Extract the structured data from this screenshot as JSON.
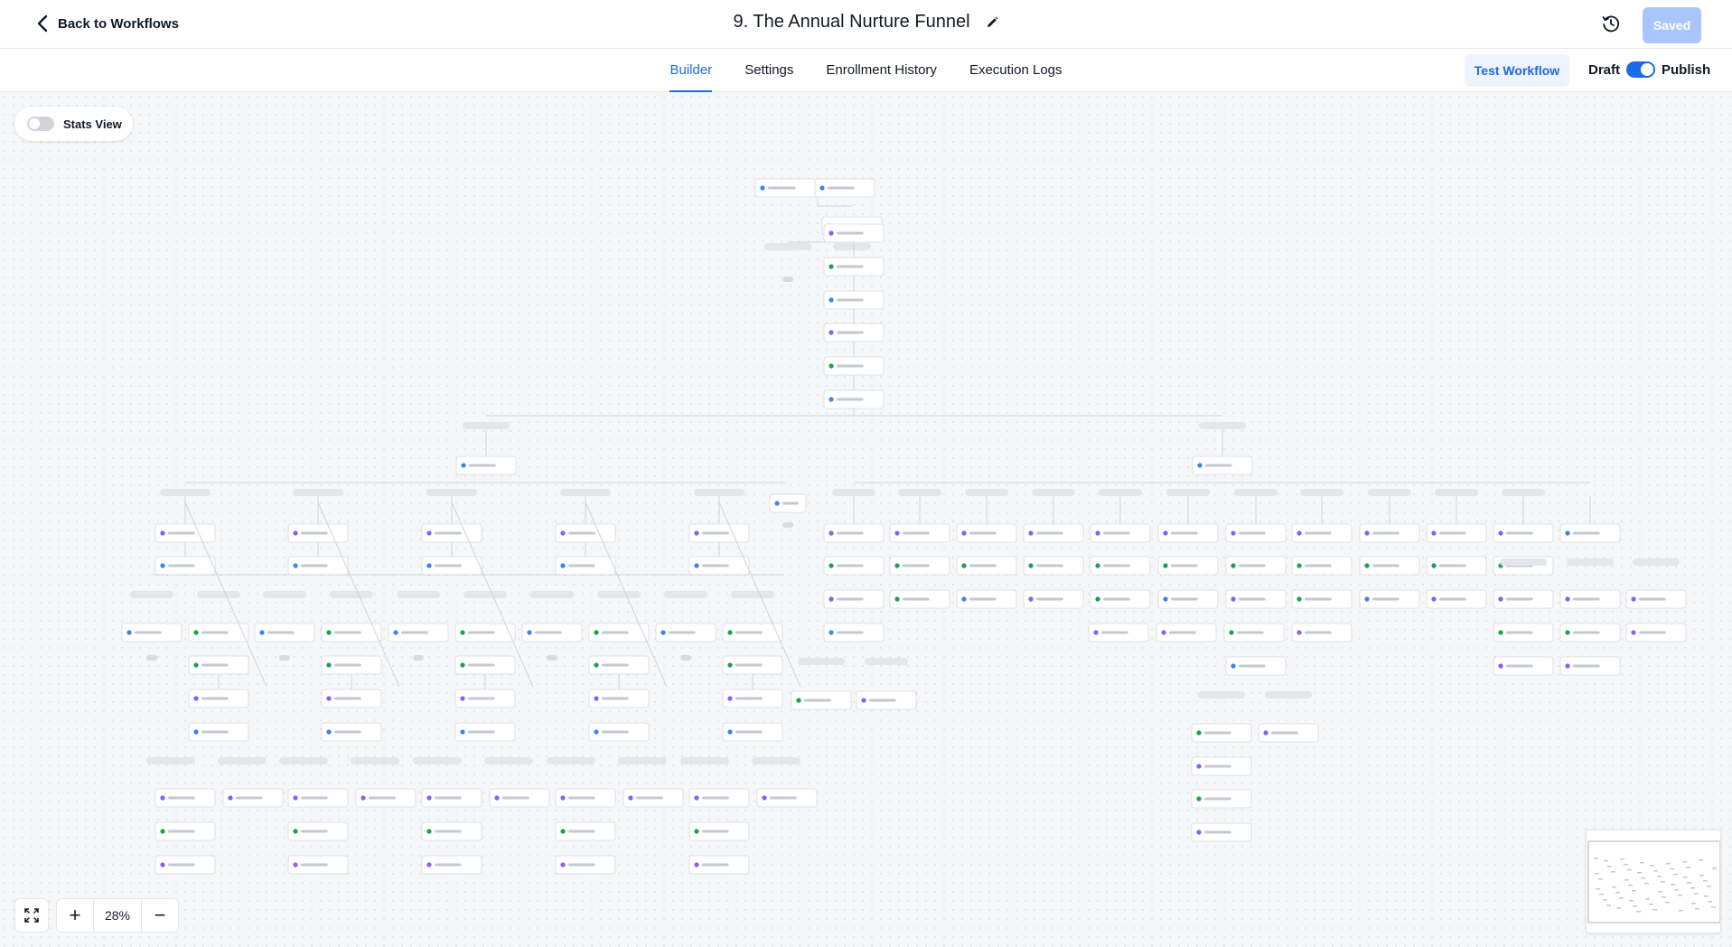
{
  "header": {
    "back_label": "Back to Workflows",
    "title": "9. The Annual Nurture Funnel",
    "saved_label": "Saved"
  },
  "tabs": [
    {
      "label": "Builder",
      "active": true
    },
    {
      "label": "Settings",
      "active": false
    },
    {
      "label": "Enrollment History",
      "active": false
    },
    {
      "label": "Execution Logs",
      "active": false
    }
  ],
  "actions": {
    "test_label": "Test Workflow",
    "draft_label": "Draft",
    "publish_label": "Publish",
    "publish_on": true
  },
  "canvas": {
    "stats_label": "Stats View",
    "stats_on": false,
    "zoom": "28%",
    "zoom_in": "+",
    "zoom_out": "−"
  },
  "colors": {
    "accent": "#1d6ae5",
    "saved_bg": "#a9c5fb",
    "node_purple": "#8b5cf6",
    "node_green": "#16a34a",
    "node_blue": "#3b82f6"
  }
}
